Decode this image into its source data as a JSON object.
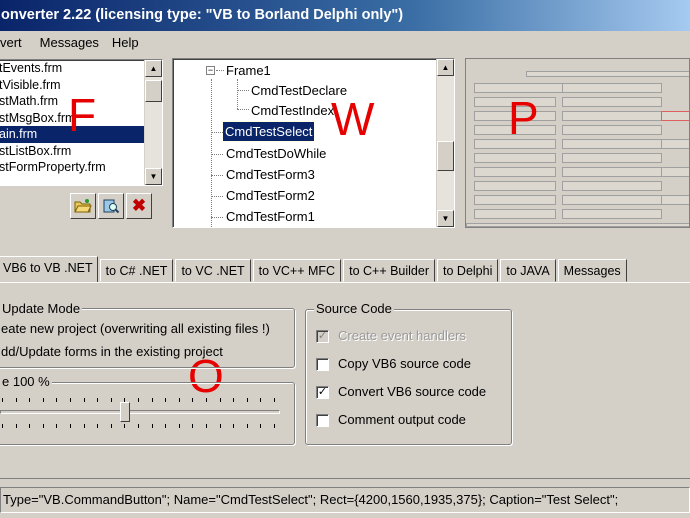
{
  "window": {
    "title": "onverter 2.22 (licensing type: \"VB to Borland Delphi only\")"
  },
  "menu": {
    "items": [
      "vert",
      "Messages",
      "Help"
    ]
  },
  "file_list": {
    "items": [
      "tEvents.frm",
      "tVisible.frm",
      "stMath.frm",
      "stMsgBox.frm",
      "ain.frm",
      "stListBox.frm",
      "stFormProperty.frm"
    ],
    "selected_index": 4
  },
  "toolbar": {
    "open_icon": "folder-open-icon",
    "browse_icon": "search-files-icon",
    "delete_icon": "delete-x-icon"
  },
  "tree": {
    "root": "Frame1",
    "children": [
      "CmdTestDeclare",
      "CmdTestIndex"
    ],
    "nodes": [
      "CmdTestSelect",
      "CmdTestDoWhile",
      "CmdTestForm3",
      "CmdTestForm2",
      "CmdTestForm1"
    ],
    "selected": "CmdTestSelect"
  },
  "annotations": {
    "f": "F",
    "w": "W",
    "p": "P",
    "o": "O"
  },
  "tabs": [
    "VB6 to VB .NET",
    "to C# .NET",
    "to VC .NET",
    "to VC++ MFC",
    "to C++ Builder",
    "to Delphi",
    "to JAVA",
    "Messages"
  ],
  "update_mode": {
    "label": "Update Mode",
    "opt1": "eate new project (overwriting all existing files !)",
    "opt2": "dd/Update forms in the existing project"
  },
  "scale": {
    "label": "e 100 %",
    "value": 100
  },
  "source_code": {
    "label": "Source Code",
    "options": [
      {
        "label": "Create event handlers",
        "checked": true,
        "disabled": true
      },
      {
        "label": "Copy VB6 source code",
        "checked": false,
        "disabled": false
      },
      {
        "label": "Convert VB6 source code",
        "checked": true,
        "disabled": false
      },
      {
        "label": "Comment output code",
        "checked": false,
        "disabled": false
      }
    ]
  },
  "status": {
    "text": "Type=\"VB.CommandButton\";  Name=\"CmdTestSelect\";  Rect={4200,1560,1935,375};  Caption=\"Test Select\";"
  }
}
